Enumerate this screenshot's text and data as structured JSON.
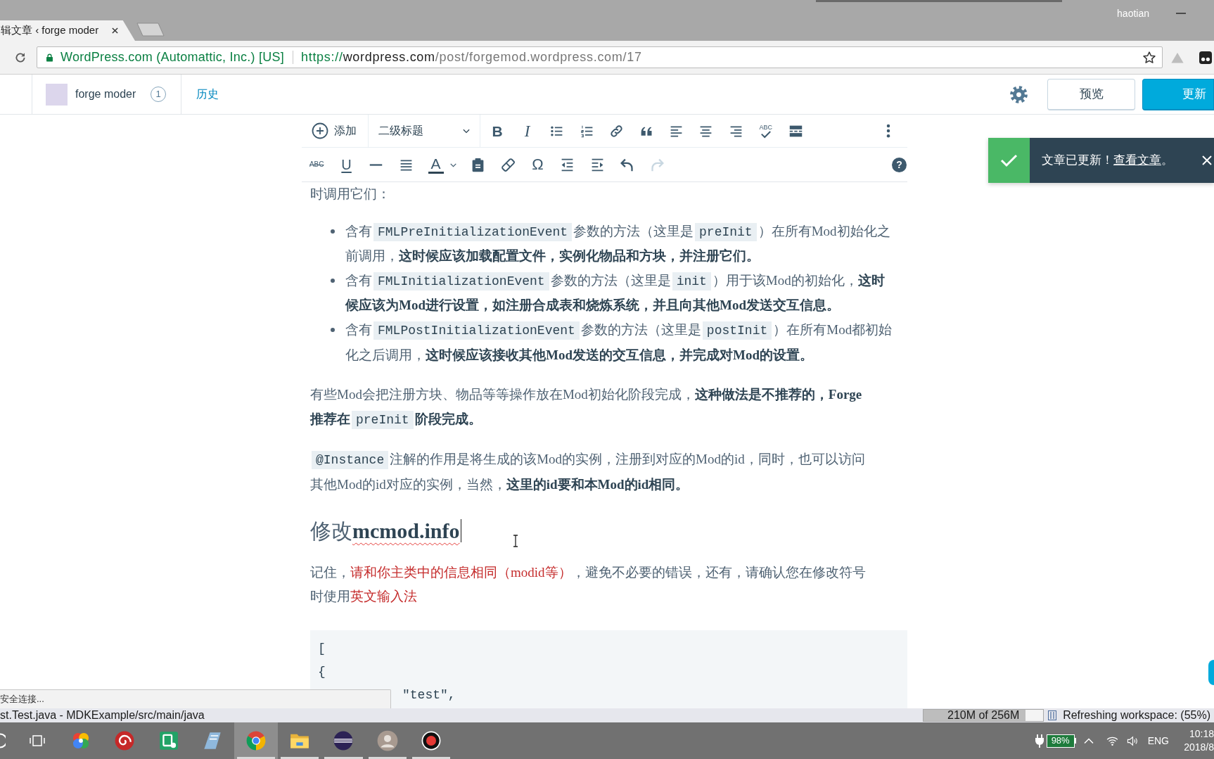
{
  "browser": {
    "window_user": "haotian",
    "tabs": [
      {
        "title": "辑文章 ‹ forge moder",
        "selected": true
      }
    ],
    "address_bar": {
      "identity": "WordPress.com (Automattic, Inc.) [US]",
      "url_scheme": "https://",
      "url_host": "wordpress.com",
      "url_path": "/post/forgemod.wordpress.com/17"
    }
  },
  "masthead": {
    "site_name": "forge moder",
    "site_count": "1",
    "history_link": "历史",
    "preview_button": "预览",
    "update_button": "更新"
  },
  "editor_toolbar": {
    "add_label": "添加",
    "format_label": "二级标题",
    "bold_glyph": "B",
    "italic_glyph": "I",
    "spellcheck_glyph": "ABC",
    "strikethrough_glyph": "ABC",
    "underline_glyph": "U",
    "text_color_glyph": "A",
    "special_character_glyph": "Ω",
    "help_glyph": "?",
    "redo_disabled": true
  },
  "notice": {
    "message": "文章已更新！",
    "link": "查看文章",
    "message_end": "。"
  },
  "content": [
    {
      "kind": "paragraph",
      "segments": [
        {
          "kind": "text",
          "text": "时调用它们："
        }
      ]
    },
    {
      "kind": "list",
      "items": [
        {
          "segments": [
            {
              "kind": "text",
              "text": "含有"
            },
            {
              "kind": "code",
              "text": "FMLPreInitializationEvent"
            },
            {
              "kind": "text",
              "text": "参数的方法（这里是"
            },
            {
              "kind": "code",
              "text": "preInit"
            },
            {
              "kind": "text",
              "text": "）在所有Mod初始化之前调用，**这时候应该加载配置文件，实例化物品和方块，并注册它们。**"
            }
          ]
        },
        {
          "segments": [
            {
              "kind": "text",
              "text": "含有"
            },
            {
              "kind": "code",
              "text": "FMLInitializationEvent"
            },
            {
              "kind": "text",
              "text": "参数的方法（这里是"
            },
            {
              "kind": "code",
              "text": "init"
            },
            {
              "kind": "text",
              "text": "）用于该Mod的初始化，**这时候应该为Mod进行设置，如注册合成表和烧炼系统，并且向其他Mod发送交互信息。**"
            }
          ]
        },
        {
          "segments": [
            {
              "kind": "text",
              "text": "含有"
            },
            {
              "kind": "code",
              "text": "FMLPostInitializationEvent"
            },
            {
              "kind": "text",
              "text": "参数的方法（这里是"
            },
            {
              "kind": "code",
              "text": "postInit"
            },
            {
              "kind": "text",
              "text": "）在所有Mod都初始化之后调用，**这时候应该接收其他Mod发送的交互信息，并完成对Mod的设置。**"
            }
          ]
        }
      ]
    },
    {
      "kind": "paragraph",
      "segments": [
        {
          "kind": "text",
          "text": "有些Mod会把注册方块、物品等等操作放在Mod初始化阶段完成，**这种做法是不推荐的，Forge推荐在**"
        },
        {
          "kind": "code",
          "text": "preInit"
        },
        {
          "kind": "text",
          "text": "**阶段完成。**"
        }
      ]
    },
    {
      "kind": "paragraph",
      "segments": [
        {
          "kind": "code",
          "text": "@Instance"
        },
        {
          "kind": "text",
          "text": "注解的作用是将生成的该Mod的实例，注册到对应的Mod的id，同时，也可以访问其他Mod的id对应的实例，当然，**这里的id要和本Mod的id相同。**"
        }
      ]
    },
    {
      "kind": "heading",
      "text": "修改**mcmod.info**",
      "spelling_flagged": true,
      "caret": true
    },
    {
      "kind": "paragraph",
      "segments": [
        {
          "kind": "text",
          "text": "记住，"
        },
        {
          "kind": "warning",
          "text": "请和你主类中的信息相同（modid等）"
        },
        {
          "kind": "text",
          "text": "，避免不必要的错误，还有，请确认您在修改符号时使用"
        },
        {
          "kind": "warning",
          "text": "英文输入法"
        }
      ]
    },
    {
      "kind": "code",
      "lines": [
        {
          "text": "["
        },
        {
          "text": "{",
          "children": [
            {
              "text": "\"test\","
            }
          ]
        }
      ]
    }
  ],
  "status_bubble": "安全连接...",
  "eclipse_status": {
    "title": "st.Test.java - MDKExample/src/main/java",
    "heap": {
      "text": "210M of 256M",
      "level": 0.85
    },
    "job": "Refreshing workspace: (55%)"
  },
  "taskbar": {
    "apps": [
      {
        "selected": false,
        "running": false
      },
      {
        "selected": false,
        "running": false
      },
      {
        "selected": false,
        "running": false
      },
      {
        "selected": false,
        "running": false
      },
      {
        "selected": false,
        "running": false
      },
      {
        "selected": true,
        "running": true
      },
      {
        "selected": false,
        "running": true
      },
      {
        "selected": false,
        "running": true
      },
      {
        "selected": false,
        "running": true
      },
      {
        "selected": false,
        "running": true
      }
    ],
    "battery": "98%",
    "language": "ENG",
    "time": "10:18",
    "date": "2018/8"
  }
}
